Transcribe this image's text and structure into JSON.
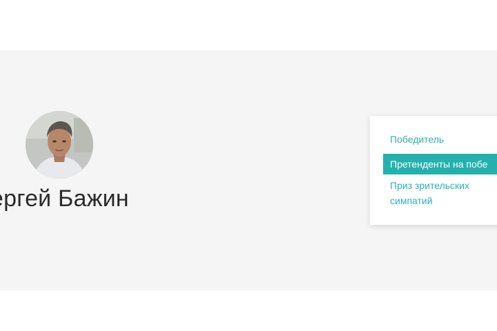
{
  "profile": {
    "name": "ергей Бажин"
  },
  "menu": {
    "items": [
      {
        "label": "Победитель"
      },
      {
        "label": "Претенденты на побе"
      },
      {
        "label": "Приз зрительских симпатий"
      }
    ]
  },
  "colors": {
    "accent": "#24b1ae",
    "link": "#2ab3b1",
    "band": "#f5f5f5",
    "text": "#2b2b2b"
  }
}
